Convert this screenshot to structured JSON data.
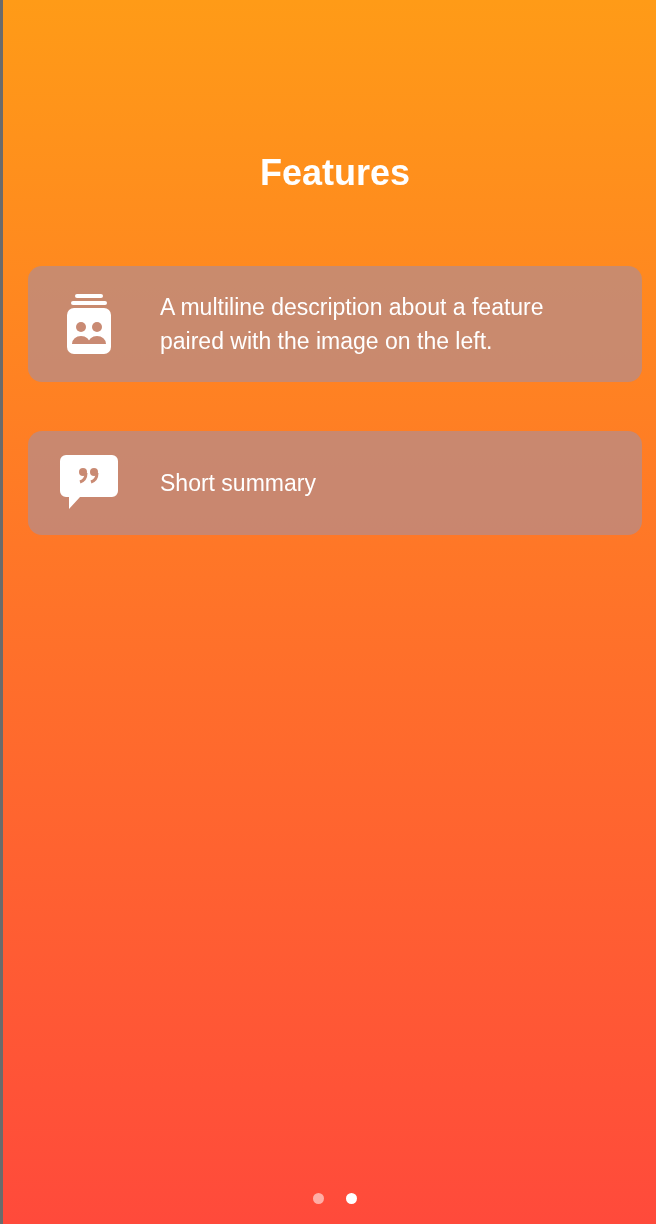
{
  "title": "Features",
  "features": [
    {
      "kind": "contacts",
      "text": "A multiline description about a feature paired with the image on the left."
    },
    {
      "kind": "quote",
      "text": "Short summary"
    }
  ],
  "pages": [
    {
      "selected": false
    },
    {
      "selected": true
    }
  ]
}
